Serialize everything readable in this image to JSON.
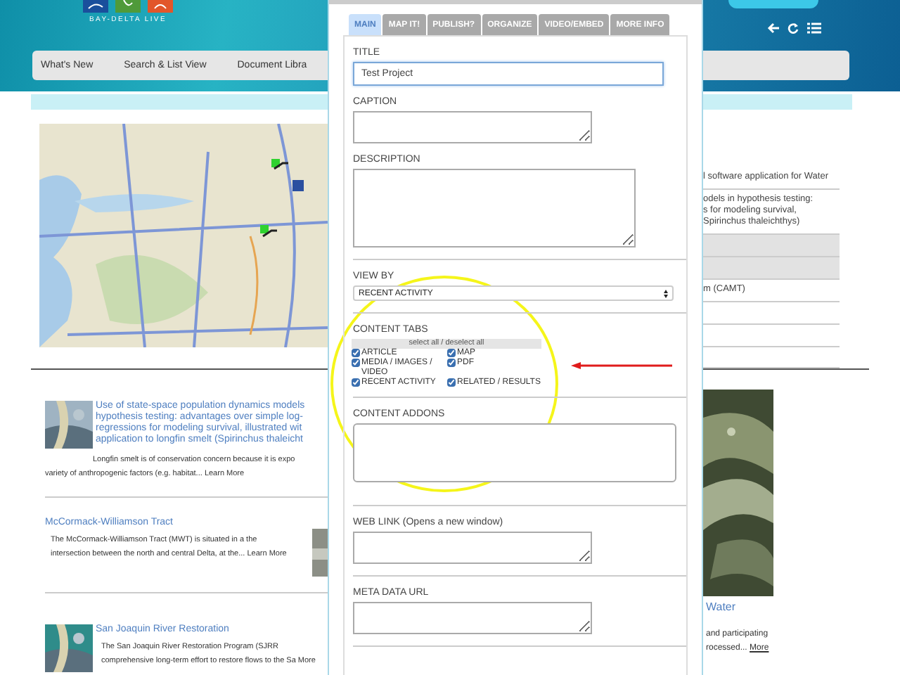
{
  "header": {
    "logo_text": "BAY-DELTA LIVE",
    "nav": [
      "What's New",
      "Search & List View",
      "Document Libra"
    ]
  },
  "right_rows": [
    {
      "lines": [
        "l software application for Water"
      ],
      "shaded": false
    },
    {
      "lines": [
        "odels in hypothesis testing:",
        "s for modeling survival,",
        "Spirinchus thaleichthys)"
      ],
      "shaded": false
    },
    {
      "lines": [],
      "shaded": true
    },
    {
      "lines": [],
      "shaded": true
    },
    {
      "lines": [
        "m (CAMT)"
      ],
      "shaded": false
    },
    {
      "lines": [],
      "shaded": false
    },
    {
      "lines": [],
      "shaded": false
    },
    {
      "lines": [],
      "shaded": false
    }
  ],
  "articles": [
    {
      "kind": "wrap",
      "title": [
        "Use of state-space population dynamics models",
        "hypothesis testing: advantages over simple log-",
        "regressions for modeling survival, illustrated wit",
        "application to longfin smelt (Spirinchus thaleicht"
      ],
      "desc": [
        "Longfin smelt is of conservation concern because it is expo",
        "variety of anthropogenic factors (e.g. habitat..."
      ],
      "link": "Learn More"
    },
    {
      "kind": "right-thumb",
      "title": [
        "McCormack-Williamson Tract"
      ],
      "desc": [
        "The McCormack-Williamson Tract (MWT) is situated in a the",
        "intersection between the north and central Delta, at the..."
      ],
      "link": "Learn More"
    },
    {
      "kind": "side",
      "title": [
        "San Joaquin River Restoration"
      ],
      "desc": [
        "The San Joaquin River Restoration Program (SJRR",
        "comprehensive long-term effort to restore flows to the Sa"
      ],
      "link": "More"
    }
  ],
  "feature": {
    "title": "Water",
    "desc": [
      "and participating",
      "rocessed..."
    ],
    "link": "More"
  },
  "modal": {
    "tabs": [
      {
        "label": "MAIN",
        "selected": true
      },
      {
        "label": "MAP IT!",
        "selected": false
      },
      {
        "label": "PUBLISH?",
        "selected": false
      },
      {
        "label": "ORGANIZE",
        "selected": false
      },
      {
        "label": "VIDEO/EMBED",
        "selected": false
      },
      {
        "label": "MORE INFO",
        "selected": false
      }
    ],
    "sections": [
      {
        "kind": "input",
        "label": "TITLE",
        "value": "Test Project"
      },
      {
        "kind": "short-area",
        "label": "CAPTION"
      },
      {
        "kind": "tall-area",
        "label": "DESCRIPTION"
      },
      {
        "kind": "select",
        "label": "VIEW BY",
        "value": "RECENT ACTIVITY"
      },
      {
        "kind": "checks",
        "label": "CONTENT TABS",
        "select_all": "select all / deselect all",
        "options": [
          {
            "label": "ARTICLE",
            "checked": true
          },
          {
            "label": "MAP",
            "checked": true
          },
          {
            "label": "MEDIA / IMAGES / VIDEO",
            "checked": true
          },
          {
            "label": "PDF",
            "checked": true
          },
          {
            "label": "RECENT ACTIVITY",
            "checked": true
          },
          {
            "label": "RELATED / RESULTS",
            "checked": true
          }
        ]
      },
      {
        "kind": "wide-area",
        "label": "CONTENT ADDONS"
      },
      {
        "kind": "short-area",
        "label": "WEB LINK (Opens a new window)"
      },
      {
        "kind": "short-area",
        "label": "META DATA URL"
      }
    ]
  }
}
